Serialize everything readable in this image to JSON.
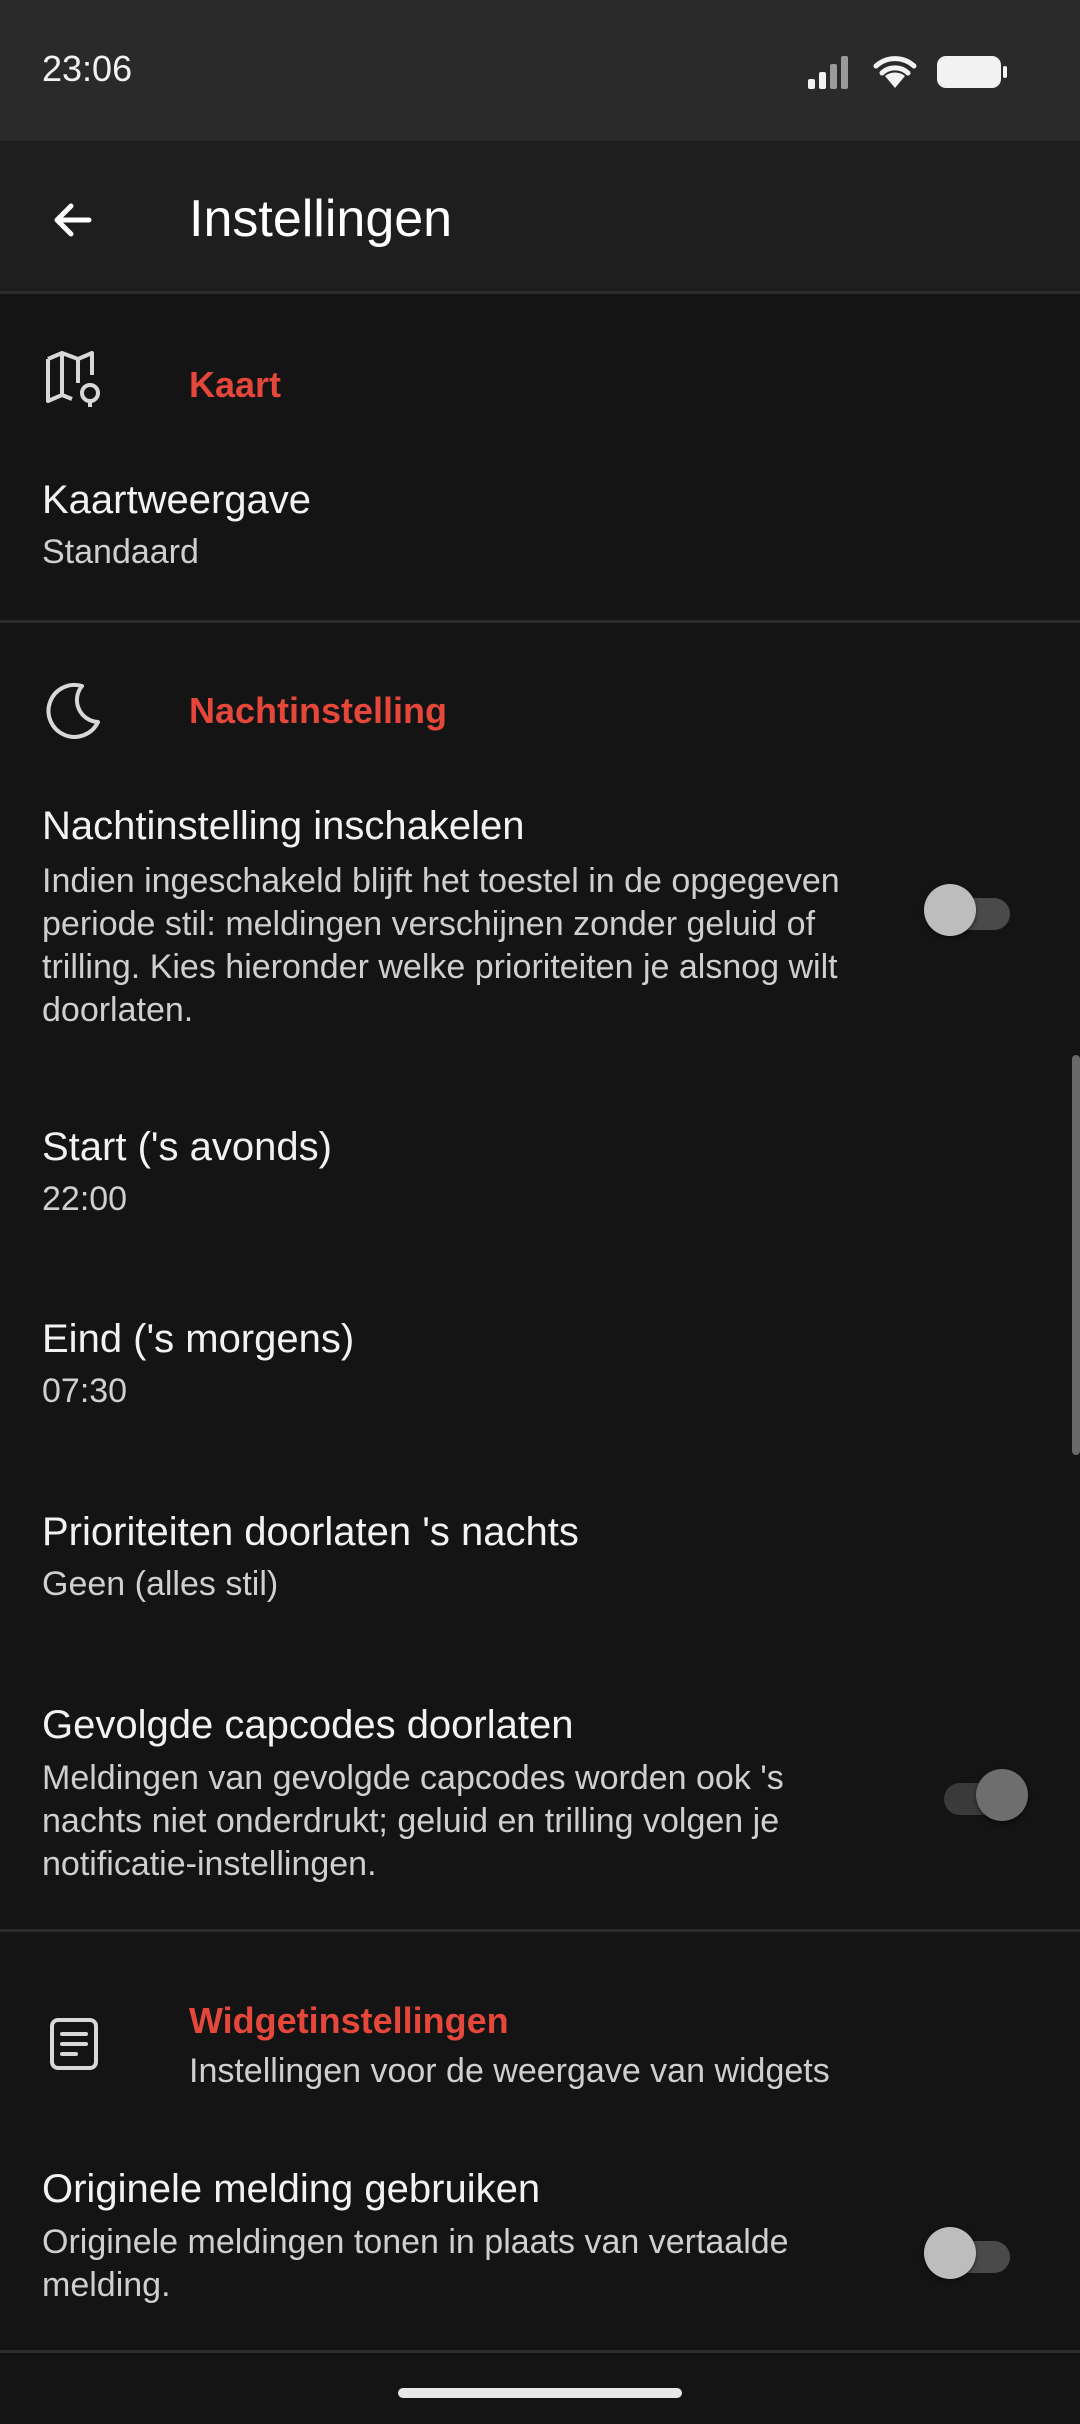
{
  "status_bar": {
    "time": "23:06"
  },
  "app_bar": {
    "title": "Instellingen"
  },
  "sections": {
    "kaart": {
      "title": "Kaart",
      "icon": "map-pin-icon",
      "rows": [
        {
          "title": "Kaartweergave",
          "value": "Standaard"
        }
      ]
    },
    "nacht": {
      "title": "Nachtinstelling",
      "icon": "moon-icon",
      "enable": {
        "title": "Nachtinstelling inschakelen",
        "description": "Indien ingeschakeld blijft het toestel in de opgegeven periode stil: meldingen verschijnen zonder geluid of trilling. Kies hieronder welke prioriteiten je alsnog wilt doorlaten.",
        "enabled": false
      },
      "start": {
        "title": "Start ('s avonds)",
        "value": "22:00"
      },
      "end": {
        "title": "Eind ('s morgens)",
        "value": "07:30"
      },
      "priorities": {
        "title": "Prioriteiten doorlaten 's nachts",
        "value": "Geen (alles stil)"
      },
      "capcodes": {
        "title": "Gevolgde capcodes doorlaten",
        "description": "Meldingen van gevolgde capcodes worden ook 's nachts niet onderdrukt; geluid en trilling volgen je notificatie-instellingen.",
        "enabled": true
      }
    },
    "widget": {
      "title": "Widgetinstellingen",
      "subtitle": "Instellingen voor de weergave van widgets",
      "icon": "widget-icon",
      "original": {
        "title": "Originele melding gebruiken",
        "description": "Originele meldingen tonen in plaats van vertaalde melding.",
        "enabled": false
      }
    }
  },
  "colors": {
    "accent": "#e5473b",
    "background": "#141414",
    "app_bar": "#1e1e1e"
  }
}
